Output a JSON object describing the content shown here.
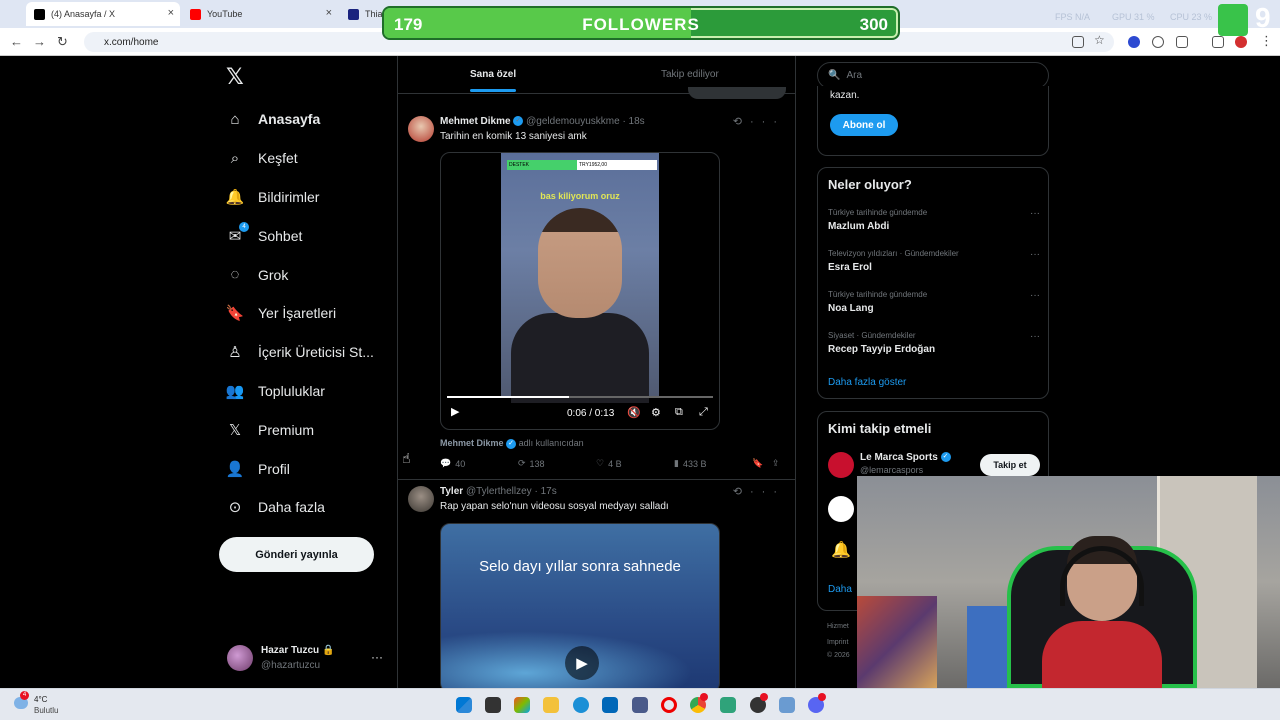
{
  "browser": {
    "tabs": [
      {
        "label": "(4) Anasayfa / X",
        "active": true
      },
      {
        "label": "YouTube",
        "active": false
      },
      {
        "label": "Thiag",
        "active": false
      }
    ],
    "url": "x.com/home"
  },
  "overlay": {
    "followers_current": "179",
    "followers_label": "FOLLOWERS",
    "followers_goal": "300",
    "followers_progress": 0.597,
    "fps_label": "FPS",
    "fps_value": "N/A",
    "gpu_label": "GPU",
    "gpu_value": "31 %",
    "cpu_label": "CPU",
    "cpu_value": "23 %",
    "k_number": "9"
  },
  "sidebar": {
    "items": [
      {
        "label": "Anasayfa",
        "icon": "home-icon",
        "active": true
      },
      {
        "label": "Keşfet",
        "icon": "search-icon"
      },
      {
        "label": "Bildirimler",
        "icon": "bell-icon"
      },
      {
        "label": "Sohbet",
        "icon": "mail-icon",
        "badge": "4"
      },
      {
        "label": "Grok",
        "icon": "grok-icon"
      },
      {
        "label": "Yer İşaretleri",
        "icon": "bookmark-icon"
      },
      {
        "label": "İçerik Üreticisi St...",
        "icon": "creator-icon"
      },
      {
        "label": "Topluluklar",
        "icon": "communities-icon"
      },
      {
        "label": "Premium",
        "icon": "x-premium-icon"
      },
      {
        "label": "Profil",
        "icon": "profile-icon"
      },
      {
        "label": "Daha fazla",
        "icon": "more-circle-icon"
      }
    ],
    "post_button": "Gönderi yayınla",
    "account": {
      "name": "Hazar Tuzcu",
      "handle": "@hazartuzcu"
    }
  },
  "feed": {
    "tabs": [
      "Sana özel",
      "Takip ediliyor"
    ],
    "tweets": [
      {
        "name": "Mehmet Dikme",
        "handle": "@geldemouyuskkme",
        "time": "· 18s",
        "text": "Tarihin en komik 13 saniyesi amk",
        "video_time": "0:06 / 0:13",
        "video_progress": 0.46,
        "donate_left": "DESTEK",
        "donate_right": "TRY1952,00",
        "video_caption": "bas kiliyorum oruz",
        "byline_name": "Mehmet Dikme",
        "byline_suffix": "adlı kullanıcıdan",
        "replies": "40",
        "reposts": "138",
        "likes": "4 B",
        "views": "433 B"
      },
      {
        "name": "Tyler",
        "handle": "@Tylerthellzey",
        "time": "· 17s",
        "text": "Rap yapan selo'nun videosu sosyal medyayı salladı",
        "media_title": "Selo dayı yıllar sonra sahnede"
      }
    ]
  },
  "right": {
    "search_placeholder": "Ara",
    "premium_text": "kazan.",
    "subscribe_button": "Abone ol",
    "trends_title": "Neler oluyor?",
    "trends": [
      {
        "context": "Türkiye tarihinde gündemde",
        "name": "Mazlum Abdi"
      },
      {
        "context": "Televizyon yıldızları · Gündemdekiler",
        "name": "Esra Erol"
      },
      {
        "context": "Türkiye tarihinde gündemde",
        "name": "Noa Lang"
      },
      {
        "context": "Siyaset · Gündemdekiler",
        "name": "Recep Tayyip Erdoğan"
      }
    ],
    "show_more": "Daha fazla göster",
    "who_title": "Kimi takip etmeli",
    "who": [
      {
        "name": "Le Marca Sports",
        "handle": "@lemarcaspors",
        "button": "Takip et"
      }
    ],
    "who_more": "Daha",
    "footer": [
      "Hizmet",
      "Imprint",
      "© 2026"
    ]
  },
  "taskbar": {
    "temp": "4°C",
    "condition": "Bulutlu",
    "weather_badge": "4"
  },
  "colors": {
    "accent": "#1d9bf0",
    "background": "#000000",
    "border": "#2f3336",
    "muted_text": "#71767b",
    "followers_bar": "#58c94a"
  }
}
